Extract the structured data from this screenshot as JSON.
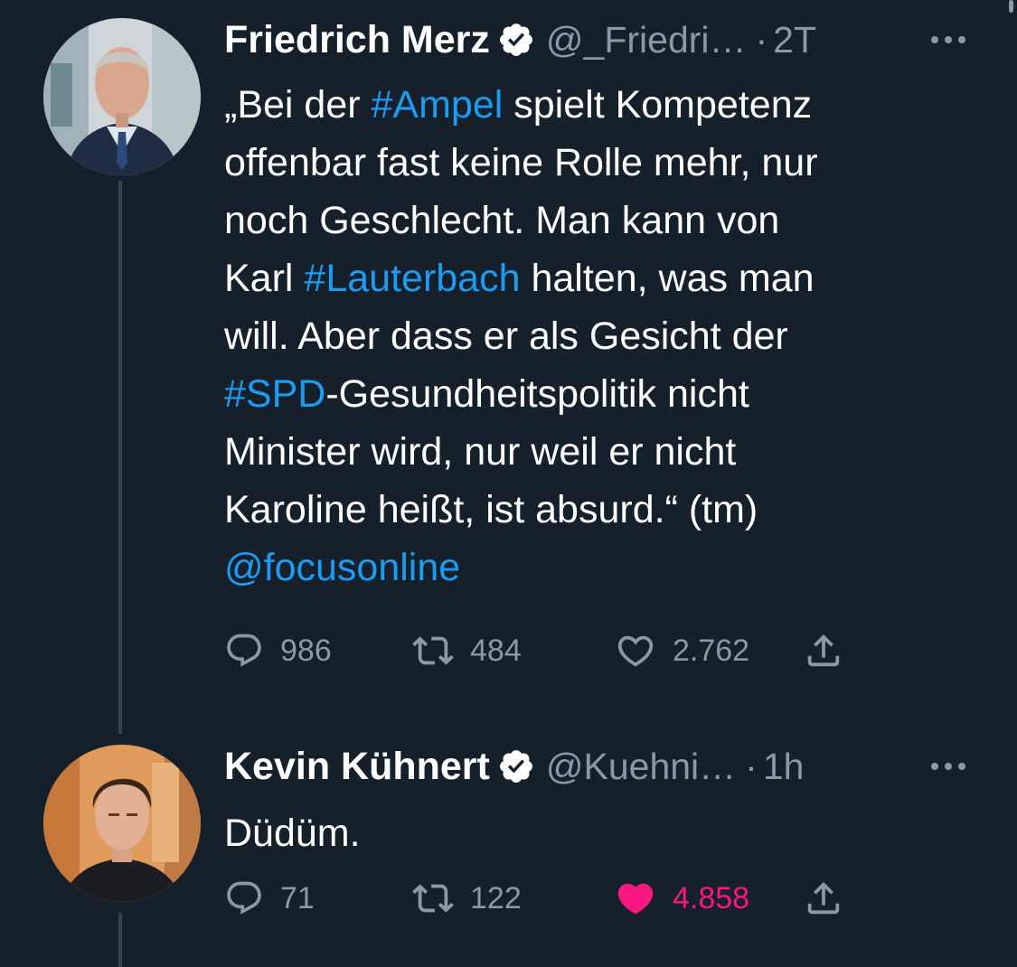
{
  "colors": {
    "background": "#15202b",
    "text": "#ffffff",
    "secondary": "#8b98a5",
    "link": "#1d9bf0",
    "like_active": "#f91880",
    "verified_badge": "#ffffff"
  },
  "tweets": [
    {
      "author": {
        "name": "Friedrich Merz",
        "verified": true,
        "handle": "@_Friedri…",
        "separator": "·",
        "time": "2T"
      },
      "text_lines": [
        [
          {
            "t": "„Bei der "
          },
          {
            "t": "#Ampel",
            "link": true
          },
          {
            "t": " spielt Kompetenz"
          }
        ],
        [
          {
            "t": "offenbar fast keine Rolle mehr, nur"
          }
        ],
        [
          {
            "t": "noch Geschlecht. Man kann von"
          }
        ],
        [
          {
            "t": "Karl "
          },
          {
            "t": "#Lauterbach",
            "link": true
          },
          {
            "t": " halten, was man"
          }
        ],
        [
          {
            "t": "will. Aber dass er als Gesicht der"
          }
        ],
        [
          {
            "t": "#SPD",
            "link": true
          },
          {
            "t": "-Gesundheitspolitik nicht"
          }
        ],
        [
          {
            "t": "Minister wird, nur weil er nicht"
          }
        ],
        [
          {
            "t": "Karoline heißt, ist absurd.“ (tm)"
          }
        ],
        [
          {
            "t": "@focusonline",
            "link": true
          }
        ]
      ],
      "actions": {
        "replies": "986",
        "retweets": "484",
        "likes": "2.762",
        "liked": false
      },
      "icons": [
        "more-icon",
        "verified-icon",
        "reply-icon",
        "retweet-icon",
        "like-icon",
        "share-icon"
      ]
    },
    {
      "author": {
        "name": "Kevin Kühnert",
        "verified": true,
        "handle": "@Kuehni…",
        "separator": "·",
        "time": "1h"
      },
      "text_lines": [
        [
          {
            "t": "Düdüm."
          }
        ]
      ],
      "actions": {
        "replies": "71",
        "retweets": "122",
        "likes": "4.858",
        "liked": true
      },
      "icons": [
        "more-icon",
        "verified-icon",
        "reply-icon",
        "retweet-icon",
        "like-filled-icon",
        "share-icon"
      ]
    }
  ]
}
